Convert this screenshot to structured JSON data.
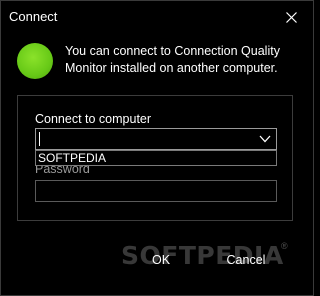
{
  "window": {
    "title": "Connect",
    "close_icon": "close-icon"
  },
  "status": {
    "color": "#67c917",
    "icon": "status-dot"
  },
  "message": "You can connect to Connection Quality Monitor installed on another computer.",
  "form": {
    "computer_label": "Connect to computer",
    "computer_value": "",
    "dropdown_options": [
      "SOFTPEDIA"
    ],
    "password_label": "Password",
    "password_value": ""
  },
  "buttons": {
    "ok_label": "OK",
    "cancel_label": "Cancel"
  },
  "watermark": {
    "text": "SOFTPEDIA",
    "registered": "®"
  }
}
